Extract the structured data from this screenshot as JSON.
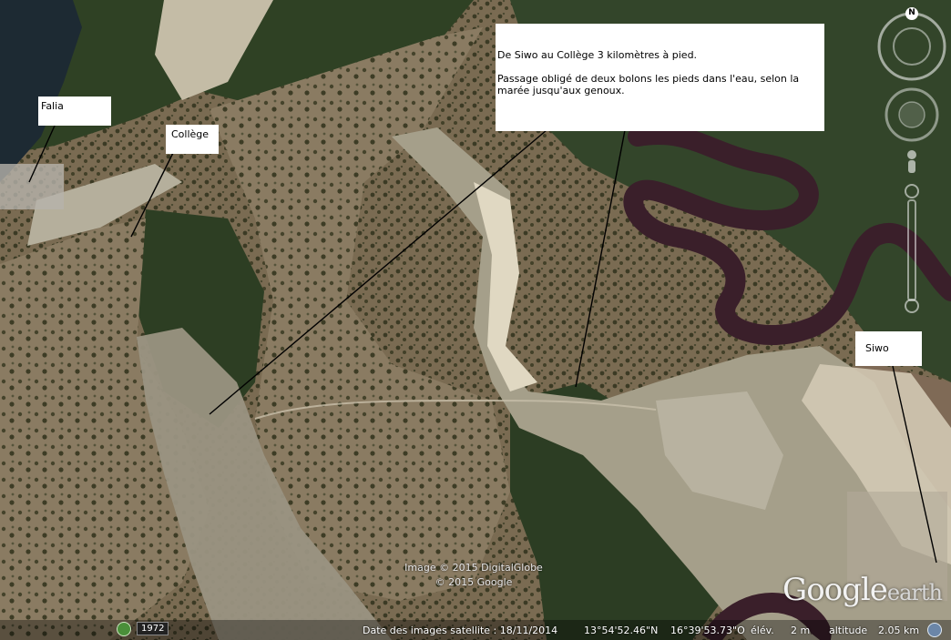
{
  "labels": {
    "falia": "Falia",
    "college": "Collège",
    "siwo": "Siwo",
    "note": "De Siwo au Collège 3 kilomètres à pied.\n\nPassage obligé de deux bolons les pieds dans l'eau, selon la marée jusqu'aux genoux."
  },
  "copyright": {
    "line1": "Image © 2015 DigitalGlobe",
    "line2": "© 2015 Google"
  },
  "logo": {
    "main": "Google",
    "suffix": "earth"
  },
  "status": {
    "year": "1972",
    "imagery_date": "Date des images satellite : 18/11/2014",
    "lat": "13°54'52.46\"N",
    "lon": "16°39'53.73\"O",
    "elev_label": "élév.",
    "elev_value": "2 m",
    "alt_label": "altitude",
    "alt_value": "2.05 km"
  },
  "navigation": {
    "north": "N"
  },
  "colors": {
    "river": "#3a1f2a",
    "mangrove": "#2e3f22",
    "sand": "#c9bda3",
    "bush": "#6e6048",
    "mud": "#8a8472"
  }
}
